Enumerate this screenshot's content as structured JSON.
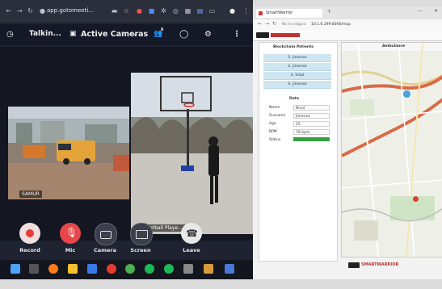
{
  "browser": {
    "url": "app.gotomeeti...",
    "nav_icons": [
      "back-icon",
      "forward-icon",
      "reload-icon",
      "lock-icon"
    ]
  },
  "meeting": {
    "title": "Talkin...",
    "view_label": "Active Cameras",
    "participant_count": "6"
  },
  "tiles": {
    "left_label": "SAMUR",
    "right_label": "Basketball Playe..."
  },
  "controls": {
    "record": "Record",
    "mic": "Mic",
    "camera": "Camera",
    "screen": "Screen",
    "leave": "Leave"
  },
  "right_window": {
    "tab_title": "SmartWarrior",
    "address": "No es seguro",
    "address_host": "10.1.6.199:8000/map",
    "panel_title": "Blockchain Patients",
    "patients": [
      "S. Jimenez",
      "S. Jimenez",
      "S. Vidal",
      "S. Jimenez"
    ],
    "info_title": "Data",
    "fields": [
      {
        "k": "Name",
        "v": "Nicol"
      },
      {
        "k": "Surname",
        "v": "Jimenez"
      },
      {
        "k": "Age",
        "v": "25"
      },
      {
        "k": "BPM",
        "v": "78 bpm"
      },
      {
        "k": "Status",
        "v": ""
      }
    ],
    "map_title": "Ambulance",
    "footer_brand": "SMARTWARRIOR"
  },
  "colors": {
    "record": "#f1dede",
    "mic": "#e5474b",
    "leave": "#e8e8e8",
    "panel_btn": "#cfe6f1",
    "status_bar": "#3aa045"
  }
}
